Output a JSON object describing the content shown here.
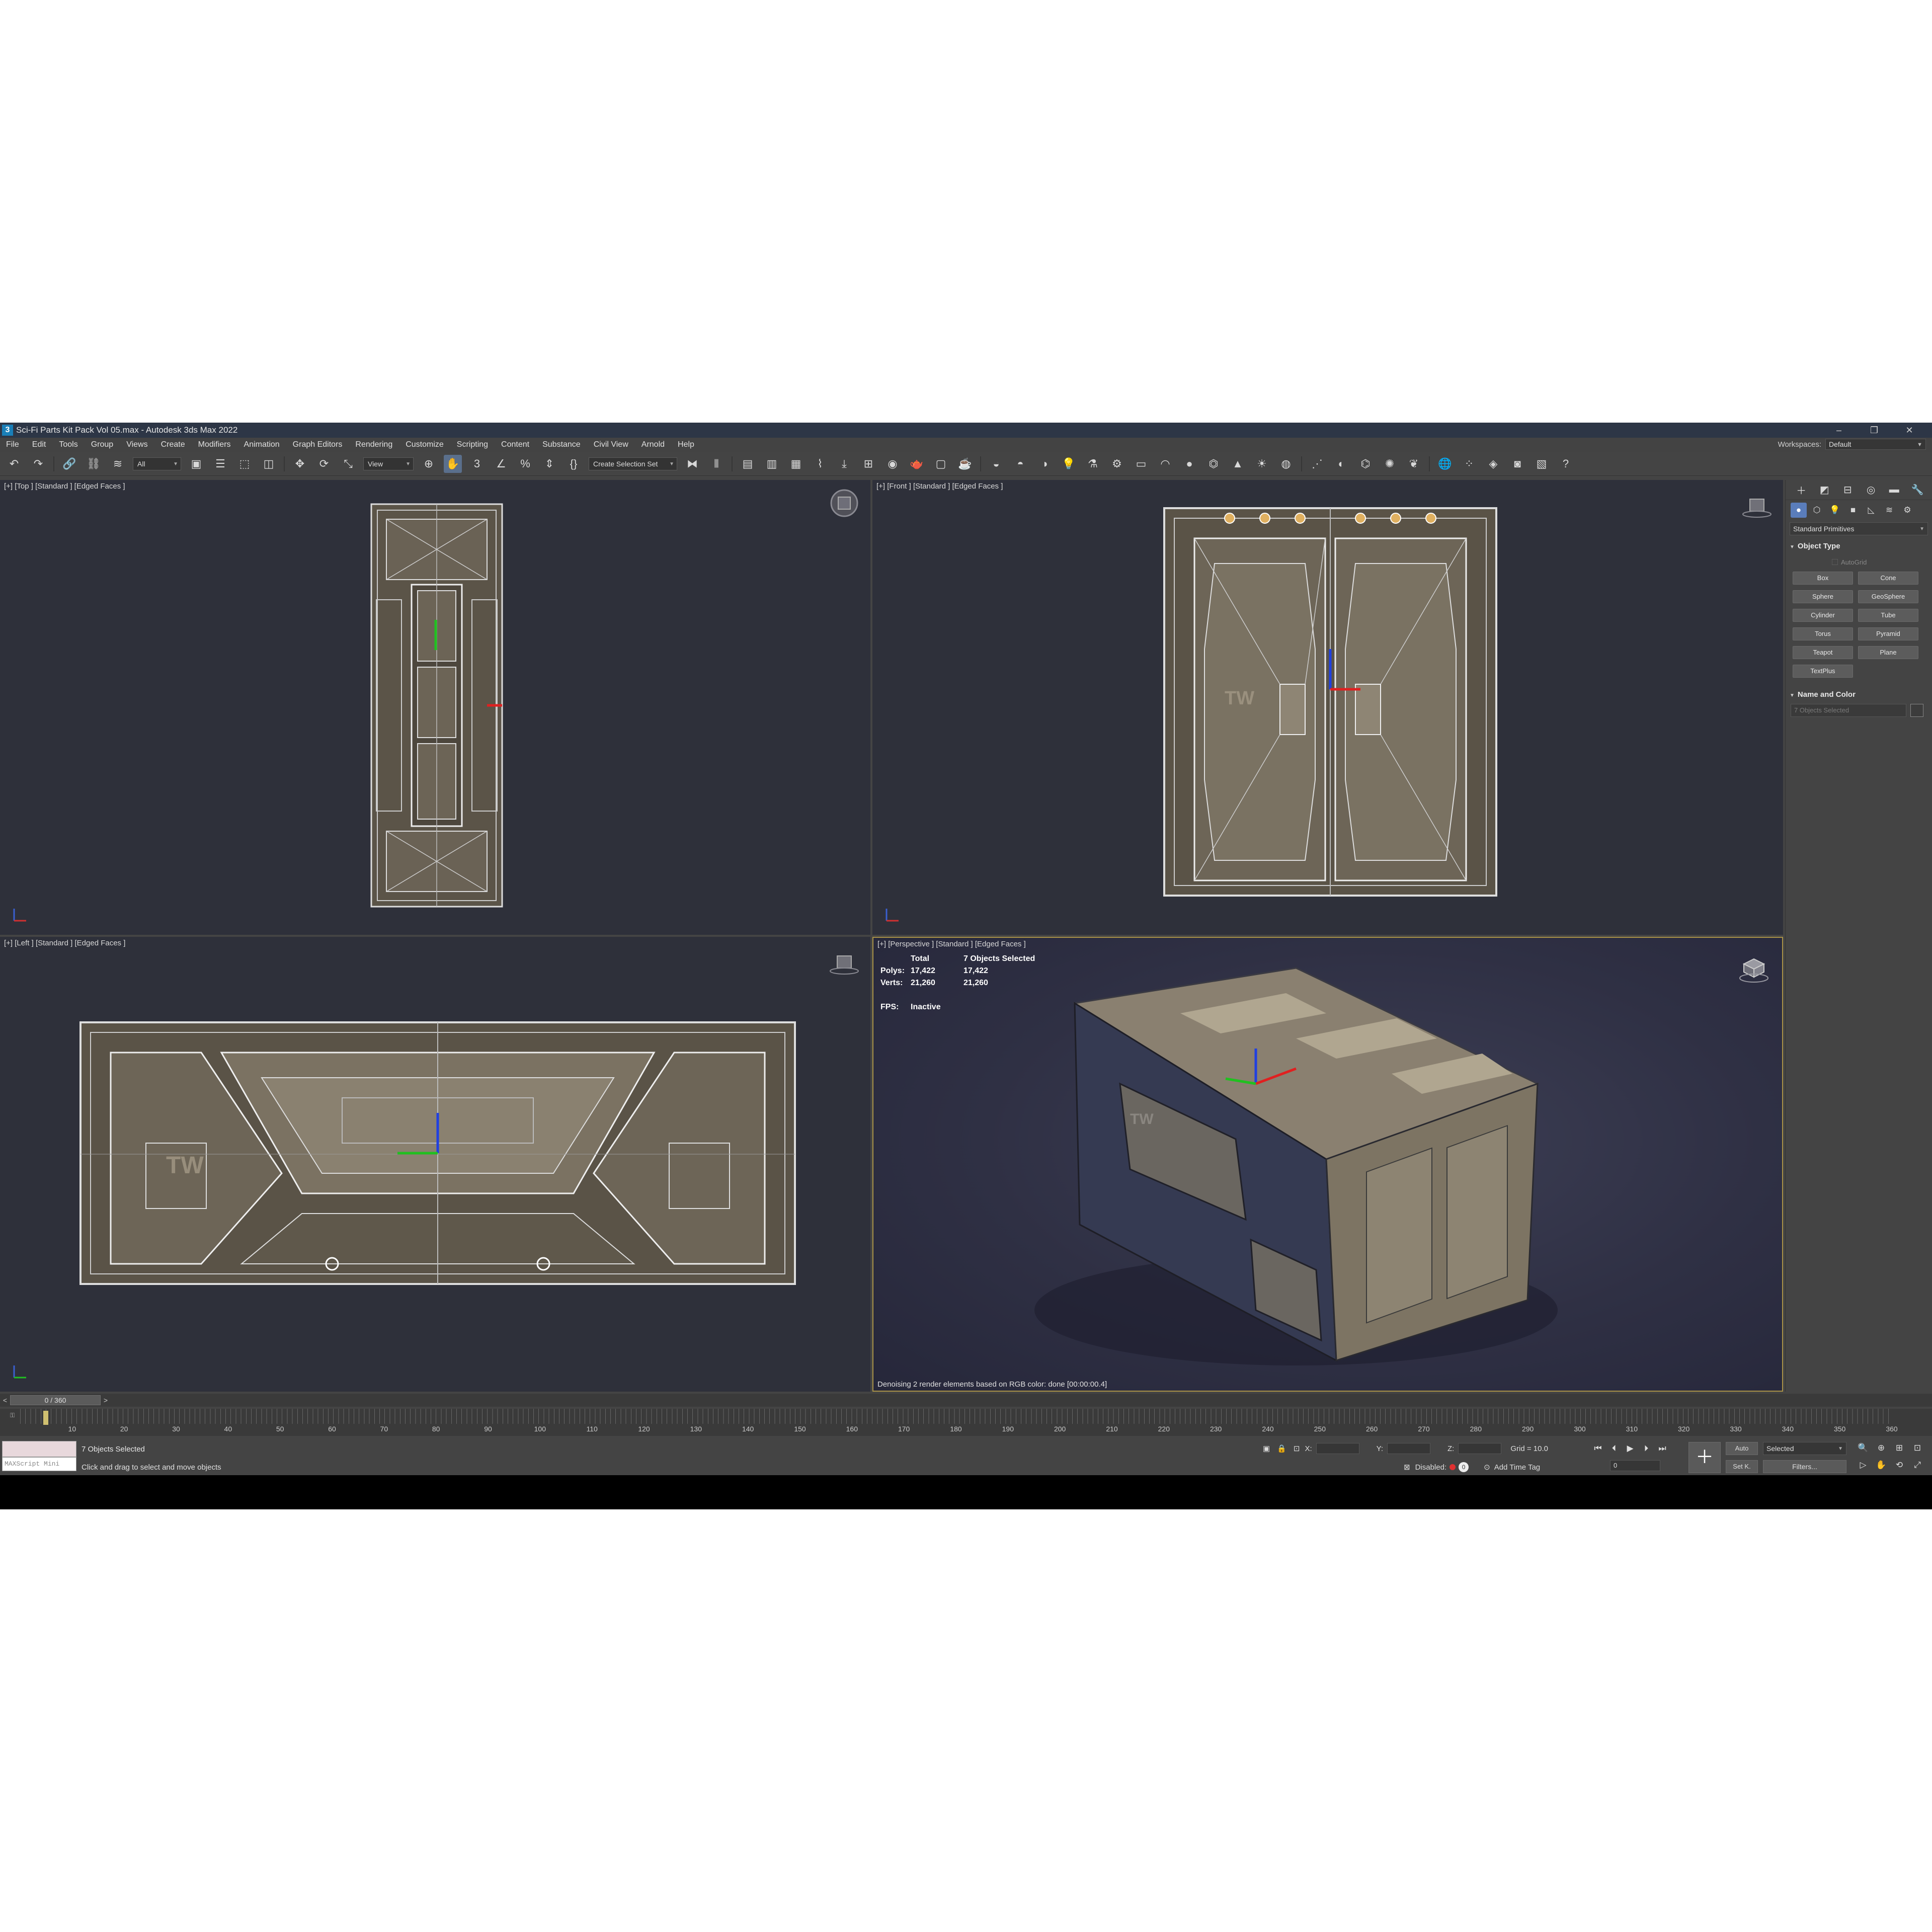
{
  "window": {
    "title": "Sci-Fi Parts Kit Pack Vol 05.max - Autodesk 3ds Max 2022",
    "app_icon": "3",
    "controls": [
      "–",
      "❐",
      "✕"
    ]
  },
  "menu": [
    "File",
    "Edit",
    "Tools",
    "Group",
    "Views",
    "Create",
    "Modifiers",
    "Animation",
    "Graph Editors",
    "Rendering",
    "Customize",
    "Scripting",
    "Content",
    "Substance",
    "Civil View",
    "Arnold",
    "Help"
  ],
  "workspace": {
    "label": "Workspaces:",
    "value": "Default"
  },
  "toolbar": {
    "filter_value": "All",
    "refcoord_value": "View",
    "selection_set_value": "Create Selection Set"
  },
  "viewports": {
    "top": {
      "label": "[+] [Top ] [Standard ] [Edged Faces ]"
    },
    "front": {
      "label": "[+] [Front ] [Standard ] [Edged Faces ]"
    },
    "left": {
      "label": "[+] [Left ] [Standard ] [Edged Faces ]"
    },
    "perspective": {
      "label": "[+] [Perspective ] [Standard ] [Edged Faces ]",
      "stats": {
        "header_total": "Total",
        "header_selected": "7 Objects Selected",
        "polys_label": "Polys:",
        "polys_total": "17,422",
        "polys_selected": "17,422",
        "verts_label": "Verts:",
        "verts_total": "21,260",
        "verts_selected": "21,260",
        "fps_label": "FPS:",
        "fps_value": "Inactive"
      },
      "render_status": "Denoising 2 render elements based on RGB color: done [00:00:00.4]"
    }
  },
  "command_panel": {
    "category": "Standard Primitives",
    "object_type_title": "Object Type",
    "autogrid_label": "AutoGrid",
    "primitives": [
      "Box",
      "Cone",
      "Sphere",
      "GeoSphere",
      "Cylinder",
      "Tube",
      "Torus",
      "Pyramid",
      "Teapot",
      "Plane",
      "TextPlus"
    ],
    "name_color_title": "Name and Color",
    "name_value": "7 Objects Selected"
  },
  "timeline": {
    "slider_label": "0 / 360",
    "ticks": [
      "10",
      "20",
      "30",
      "40",
      "50",
      "60",
      "70",
      "80",
      "90",
      "100",
      "110",
      "120",
      "130",
      "140",
      "150",
      "160",
      "170",
      "180",
      "190",
      "200",
      "210",
      "220",
      "230",
      "240",
      "250",
      "260",
      "270",
      "280",
      "290",
      "300",
      "310",
      "320",
      "330",
      "340",
      "350",
      "360"
    ],
    "current_frame": 0
  },
  "status": {
    "maxscript_placeholder": "MAXScript Mini",
    "selection_text": "7 Objects Selected",
    "prompt_text": "Click and drag to select and move objects",
    "x_label": "X:",
    "y_label": "Y:",
    "z_label": "Z:",
    "grid_text": "Grid = 10.0",
    "disabled_label": "Disabled:",
    "add_time_tag": "Add Time Tag",
    "auto_label": "Auto",
    "setk_label": "Set K.",
    "key_filter_value": "Selected",
    "filters_label": "Filters...",
    "frame_value": "0"
  }
}
